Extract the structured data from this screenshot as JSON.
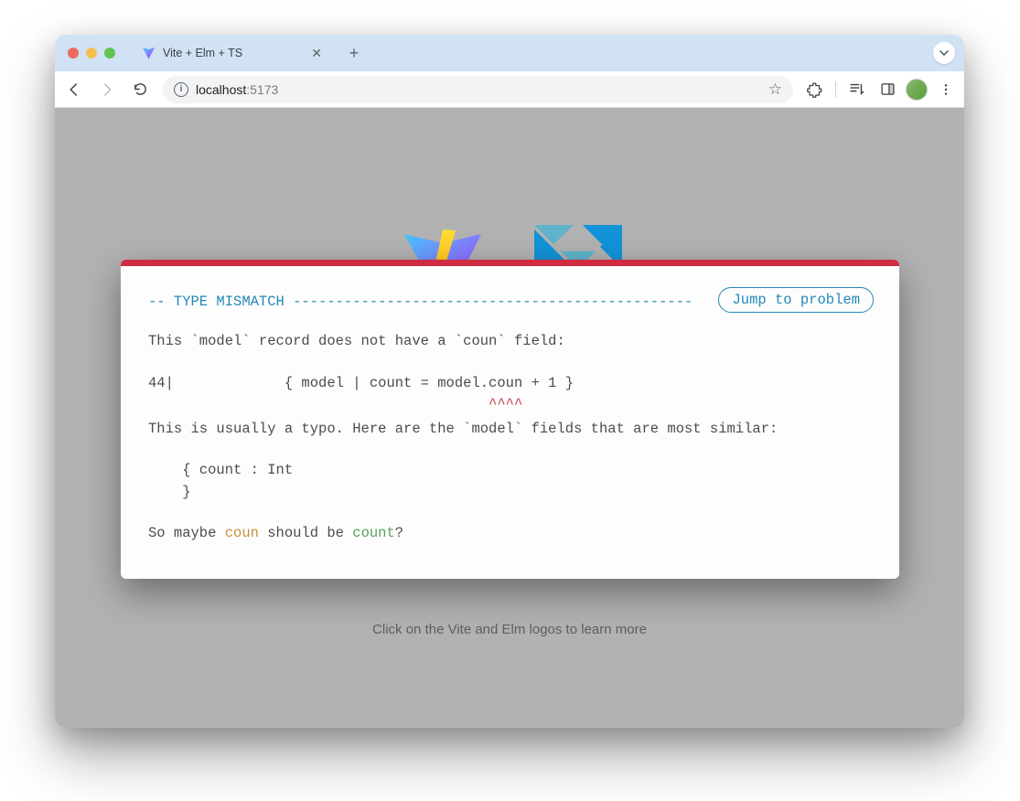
{
  "tab": {
    "title": "Vite + Elm + TS"
  },
  "address": {
    "host": "localhost",
    "port": ":5173"
  },
  "page": {
    "footer": "Click on the Vite and Elm logos to learn more"
  },
  "error": {
    "header": "-- TYPE MISMATCH -----------------------------------------------",
    "jump_label": "Jump to problem",
    "line1": "This `model` record does not have a `coun` field:",
    "code_line": "44|             { model | count = model.coun + 1 }",
    "caret_line": "                                        ^^^^",
    "line2": "This is usually a typo. Here are the `model` fields that are most similar:",
    "record_line1": "    { count : Int",
    "record_line2": "    }",
    "suggest_prefix": "So maybe ",
    "suggest_bad": "coun",
    "suggest_mid": " should be ",
    "suggest_good": "count",
    "suggest_suffix": "?"
  }
}
